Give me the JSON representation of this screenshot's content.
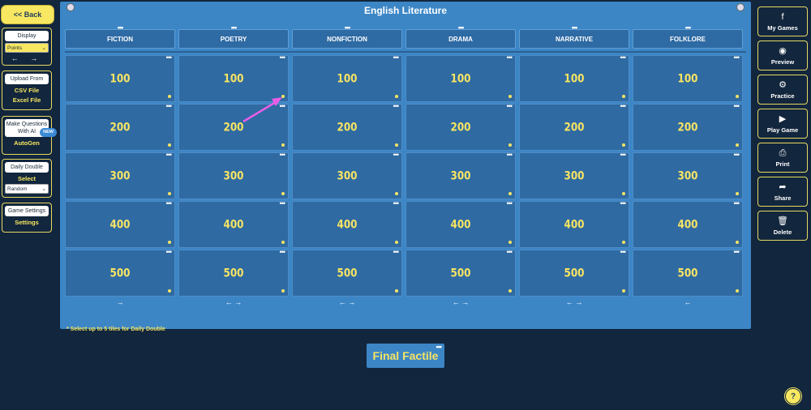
{
  "left": {
    "back_label": "<< Back",
    "display": {
      "title": "Display",
      "selected": "Points",
      "arrows": "← →"
    },
    "upload": {
      "title": "Upload From",
      "line1": "CSV File",
      "line2": "Excel File"
    },
    "ai": {
      "title_line1": "Make Questions",
      "title_line2": "With AI",
      "badge": "NEW",
      "action": "AutoGen"
    },
    "daily": {
      "title": "Daily Double",
      "action": "Select",
      "selected": "Random"
    },
    "settings": {
      "title": "Game Settings",
      "action": "Settings"
    }
  },
  "board": {
    "title": "English Literature",
    "categories": [
      "FICTION",
      "POETRY",
      "NONFICTION",
      "DRAMA",
      "NARRATIVE",
      "FOLKLORE"
    ],
    "values": [
      "100",
      "200",
      "300",
      "400",
      "500"
    ],
    "move_arrows": [
      "→",
      "← →",
      "← →",
      "← →",
      "← →",
      "←"
    ],
    "note": "* Select up to 5 tiles for Daily Double"
  },
  "final": {
    "label": "Final Factile"
  },
  "right": [
    {
      "icon": "facebook-icon",
      "glyph": "f",
      "label": "My Games"
    },
    {
      "icon": "eye-icon",
      "glyph": "◉",
      "label": "Preview"
    },
    {
      "icon": "gears-icon",
      "glyph": "⚙",
      "label": "Practice"
    },
    {
      "icon": "play-icon",
      "glyph": "▶",
      "label": "Play Game"
    },
    {
      "icon": "printer-icon",
      "glyph": "⎙",
      "label": "Print"
    },
    {
      "icon": "share-icon",
      "glyph": "➦",
      "label": "Share"
    },
    {
      "icon": "trash-icon",
      "glyph": "🗑",
      "label": "Delete"
    }
  ],
  "help": "?",
  "colors": {
    "accent": "#f8e760",
    "board": "#3c86c6",
    "tile": "#2f6aa2",
    "background": "#12263d",
    "arrow": "#e95ee8"
  }
}
